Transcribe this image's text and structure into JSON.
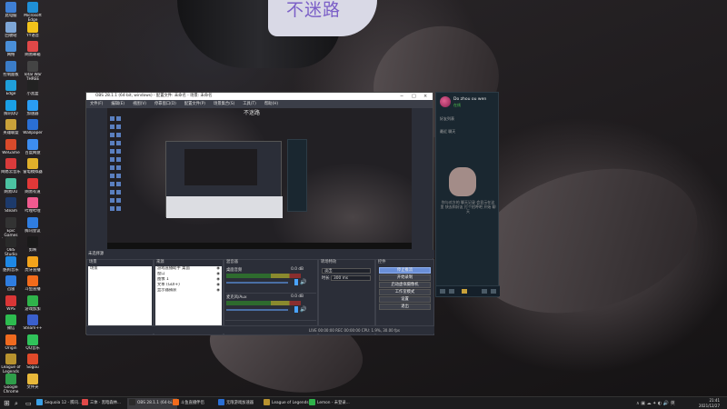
{
  "wallpaper": {
    "watermark": "不迷路"
  },
  "desktop_icons": [
    {
      "label": "此电脑",
      "color": "#3f7fd4"
    },
    {
      "label": "回收站",
      "color": "#7ea6d6"
    },
    {
      "label": "网络",
      "color": "#4a8fd8"
    },
    {
      "label": "控制面板",
      "color": "#3b7cc7"
    },
    {
      "label": "Edge",
      "color": "#1f9fd9"
    },
    {
      "label": "腾讯QQ",
      "color": "#1aa0e6"
    },
    {
      "label": "英雄联盟",
      "color": "#c9a13a"
    },
    {
      "label": "WeGame",
      "color": "#d94a2b"
    },
    {
      "label": "网易云音乐",
      "color": "#d93b3b"
    },
    {
      "label": "网易UU",
      "color": "#4cc2a2"
    },
    {
      "label": "Steam",
      "color": "#1d3a6b"
    },
    {
      "label": "Epic Games\nLauncher",
      "color": "#333333"
    },
    {
      "label": "OBS Studio",
      "color": "#2a2a2a"
    },
    {
      "label": "酷狗音乐",
      "color": "#1e88e5"
    },
    {
      "label": "迅雷",
      "color": "#2f7de0"
    },
    {
      "label": "WPS",
      "color": "#d93636"
    },
    {
      "label": "微信",
      "color": "#2dbb4f"
    },
    {
      "label": "Origin",
      "color": "#f06a1f"
    },
    {
      "label": "League of\nLegends",
      "color": "#b8922e"
    },
    {
      "label": "Google\nChrome",
      "color": "#2f9e4a"
    },
    {
      "label": "Microsoft\nEdge",
      "color": "#1f8fd6"
    },
    {
      "label": "YY语音",
      "color": "#f2c21b"
    },
    {
      "label": "网易邮箱",
      "color": "#e04848"
    },
    {
      "label": "Total War\nTHREE",
      "color": "#444444"
    },
    {
      "label": "小黑盒",
      "color": "#222222"
    },
    {
      "label": "加速器",
      "color": "#2a9df4"
    },
    {
      "label": "Wallpaper",
      "color": "#2a6fd4"
    },
    {
      "label": "百度网盘",
      "color": "#3d8df0"
    },
    {
      "label": "雷电模拟器",
      "color": "#e0b02a"
    },
    {
      "label": "网易有道",
      "color": "#e23838"
    },
    {
      "label": "哔哩哔哩",
      "color": "#f05a8f"
    },
    {
      "label": "腾讯会议",
      "color": "#2f7de0"
    },
    {
      "label": "剪映",
      "color": "#1a1a1a"
    },
    {
      "label": "虎牙直播",
      "color": "#f2a31b"
    },
    {
      "label": "斗鱼直播",
      "color": "#f26b1b"
    },
    {
      "label": "游戏加加",
      "color": "#2fb34a"
    },
    {
      "label": "Steam++",
      "color": "#3a5fcd"
    },
    {
      "label": "QQ音乐",
      "color": "#30c25a"
    },
    {
      "label": "Sogou",
      "color": "#e04a2a"
    },
    {
      "label": "文件夹",
      "color": "#e8b83a"
    }
  ],
  "obs": {
    "title": "OBS 28.1.1 (64-bit, windows) - 配置文件: 未命名 - 场景: 未命名",
    "menu": [
      "文件(F)",
      "编辑(E)",
      "视图(V)",
      "停靠窗口(D)",
      "配置文件(P)",
      "场景集合(S)",
      "工具(T)",
      "帮助(H)"
    ],
    "preview_text": "不迷路",
    "no_source": "未选择源",
    "docks": {
      "scenes": {
        "title": "场景",
        "items": [
          "场景"
        ]
      },
      "sources": {
        "title": "来源",
        "items": [
          "游戏直播助手 桌面",
          "窗口",
          "图像 1",
          "文本 (GDI+)",
          "显示器捕获"
        ]
      },
      "mixer": {
        "title": "混音器",
        "channels": [
          {
            "name": "桌面音频",
            "db": "0.0 dB"
          },
          {
            "name": "麦克风/Aux",
            "db": "0.0 dB"
          }
        ]
      },
      "transitions": {
        "title": "转场特效",
        "type": "淡出",
        "duration_label": "时长",
        "duration": "300 ms"
      },
      "controls": {
        "title": "控件",
        "buttons": [
          {
            "label": "停止推流",
            "active": true
          },
          {
            "label": "开始录制",
            "active": false
          },
          {
            "label": "启动虚拟摄像机",
            "active": false
          },
          {
            "label": "工作室模式",
            "active": false
          },
          {
            "label": "设置",
            "active": false
          },
          {
            "label": "退出",
            "active": false
          }
        ]
      }
    },
    "status": "LIVE 00:00:00   REC 00:00:00   CPU: 1.9%, 30.00 fps"
  },
  "chat": {
    "name": "Do zhou ou wen",
    "status": "在线",
    "bar": "好友列表",
    "tab": "最近 聊天",
    "message": "你与对方的 聊天记录 会显示在这里 快去和好友 打个招呼吧 开始 聊天"
  },
  "taskbar": {
    "items": [
      {
        "label": "Sequoia 12 - 腾讯...",
        "color": "#3aa0e6",
        "active": false
      },
      {
        "label": "三体 · 黑暗森林...",
        "color": "#e04848",
        "active": false
      },
      {
        "label": "OBS 28.1.1 (64-bi...",
        "color": "#2a2a2a",
        "active": true
      },
      {
        "label": "斗鱼直播伴侣",
        "color": "#f26b1b",
        "active": false
      },
      {
        "label": "无限游戏加速器",
        "color": "#2a6fd4",
        "active": false
      },
      {
        "label": "League of Legends",
        "color": "#b8922e",
        "active": false
      },
      {
        "label": "Lemon - 未登录...",
        "color": "#2fb34a",
        "active": false
      }
    ],
    "time": "21:41",
    "date": "2021/12/27"
  }
}
